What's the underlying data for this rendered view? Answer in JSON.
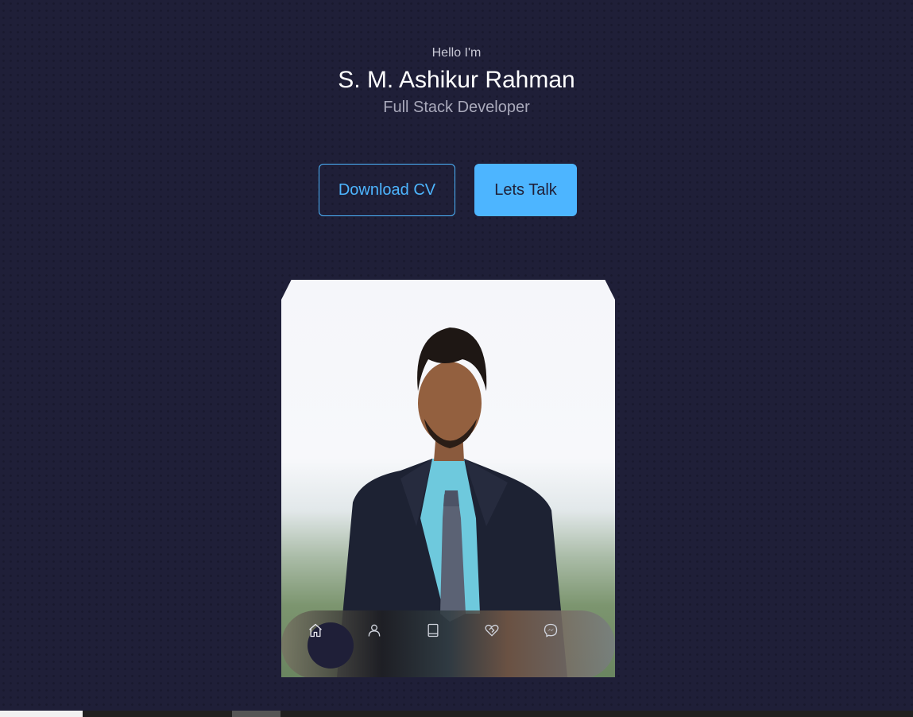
{
  "hero": {
    "greeting": "Hello I'm",
    "name": "S. M. Ashikur Rahman",
    "role": "Full Stack Developer"
  },
  "buttons": {
    "download_cv": "Download CV",
    "lets_talk": "Lets Talk"
  },
  "nav": {
    "items": [
      {
        "icon": "home-icon",
        "active": true
      },
      {
        "icon": "user-icon",
        "active": false
      },
      {
        "icon": "book-icon",
        "active": false
      },
      {
        "icon": "handshake-heart-icon",
        "active": false
      },
      {
        "icon": "messenger-icon",
        "active": false
      }
    ]
  },
  "colors": {
    "background": "#1f1f38",
    "accent": "#4db5ff",
    "text_light": "#a9a9bb"
  }
}
